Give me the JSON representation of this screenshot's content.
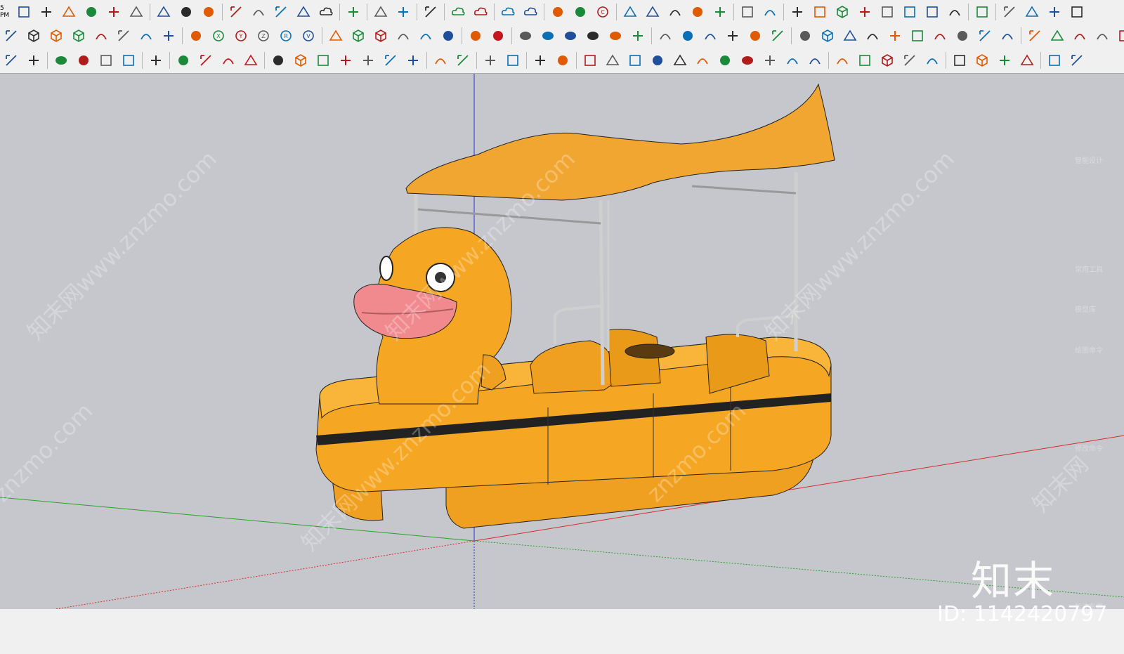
{
  "clock": "5 PM",
  "toolbar": {
    "row1": [
      "new-model-icon",
      "open-icon",
      "home-icon",
      "warehouse-icon",
      "house-icon",
      "store-icon",
      "sep",
      "extension-icon",
      "refresh-icon",
      "video-icon",
      "sep",
      "add-icon",
      "tree-icon",
      "sunrise-icon",
      "checker-icon",
      "cloud-upload-icon",
      "sep",
      "gears-icon",
      "sep",
      "mail-icon",
      "info-icon",
      "sep",
      "user-icon",
      "sep",
      "cloud-link-icon",
      "cloud-search-icon",
      "sep",
      "cloud-sync-icon",
      "cloud-edit-icon",
      "sep",
      "frame-icon",
      "flower-icon",
      "rotate-check-icon",
      "sep",
      "shape-a-icon",
      "copy-icon",
      "dimension-icon",
      "number-icon",
      "ruler-icon",
      "sep",
      "doc-icon",
      "stack-icon",
      "sep",
      "monitor-icon",
      "monitor2-icon",
      "cube-icon",
      "axis-x-icon",
      "move-x-icon",
      "arrows-icon",
      "measure-icon",
      "tape-icon",
      "sep",
      "tag-icon",
      "sep",
      "sheet-icon",
      "pen-icon",
      "export-icon",
      "export2-icon"
    ],
    "row2": [
      "curve-icon",
      "box-yellow-icon",
      "box-green-icon",
      "box-blue-icon",
      "bracket-icon",
      "wave-icon",
      "paint-icon",
      "grid-icon",
      "sep",
      "mirror-icon",
      "rotate-x-icon",
      "rotate-y-icon",
      "rotate-z-icon",
      "rotate-r-icon",
      "rotate-v-icon",
      "sep",
      "slash-icon",
      "cube-outline-icon",
      "cube-outline2-icon",
      "arch-icon",
      "leaf-icon",
      "corner-icon",
      "sep",
      "s-curve-icon",
      "s-curve-red-icon",
      "sep",
      "ellipse-icon",
      "ring-icon",
      "ellipse2-icon",
      "double-ring-icon",
      "ellipse3-icon",
      "triangle-circles-icon",
      "sep",
      "wall-icon",
      "fold-icon",
      "roof-icon",
      "roof2-icon",
      "book-icon",
      "book2-icon",
      "sep",
      "text-3d-icon",
      "box-lines-icon",
      "grid-sq-icon",
      "cylinder-icon",
      "cylinder2-icon",
      "pipe-icon",
      "pipe2-icon",
      "stair-icon",
      "spiral-icon",
      "eraser-icon",
      "sep",
      "line-tool-icon",
      "line-tool2-icon",
      "line-tool3-icon",
      "step-icon",
      "download-red-icon"
    ],
    "row3": [
      "axis-y-icon",
      "gear-select-icon",
      "sep",
      "dot-icon",
      "cone-icon",
      "line-icon",
      "rect-icon",
      "sep",
      "hide-icon",
      "sep",
      "import-icon",
      "upload-red-icon",
      "paint-red-icon",
      "settings-red-icon",
      "sep",
      "sigma-icon",
      "number-box-icon",
      "basket-icon",
      "chart-icon",
      "connect-icon",
      "square-icon",
      "down-arrow-icon",
      "sep",
      "folder-icon",
      "number8-icon",
      "sep",
      "layers-icon",
      "layers2-icon",
      "sep",
      "frame-select-icon",
      "flip-icon",
      "sep",
      "line-angle-icon",
      "square2-icon",
      "book3-icon",
      "dome-icon",
      "gauge-icon",
      "polyline-icon",
      "slash2-icon",
      "dots-icon",
      "cross-icon",
      "panel-icon",
      "basket2-icon",
      "sep",
      "up-down-icon",
      "down2-icon",
      "box3d-icon",
      "grid-select-icon",
      "pane-icon",
      "sep",
      "arc-icon",
      "box-dot-icon",
      "paint2-icon",
      "pencil-icon",
      "sep",
      "table-icon",
      "more-icon"
    ]
  },
  "viewport": {
    "model_name": "rubber-duck-paddle-boat",
    "colors": {
      "background": "#c5c7cd",
      "hull": "#f5a623",
      "hull_dark": "#d88a12",
      "beak": "#f08a8e",
      "canopy": "#f0a631",
      "rail": "#cfcfcf",
      "axis_red": "#d52b2b",
      "axis_green": "#2aa02a",
      "axis_blue": "#2233cc"
    }
  },
  "watermark": {
    "logo": "知末",
    "id": "ID: 1142420797",
    "text_items": [
      "知末网www.znzmo.com",
      "知末网www.znzmo.com",
      "知末网www.znzmo.com",
      "znzmo.com",
      "知末网www.znzmo.com",
      "znzmo.com",
      "知末网"
    ]
  },
  "right_panel": {
    "labels": [
      "智能设计",
      "常用工具",
      "模型库",
      "绘图命令",
      "修改命令",
      "标注布置"
    ]
  }
}
